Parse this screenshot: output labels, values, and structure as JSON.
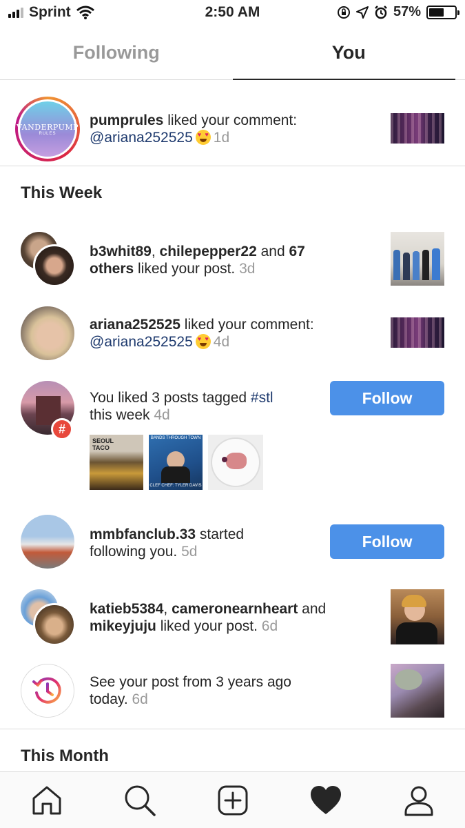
{
  "status_bar": {
    "carrier": "Sprint",
    "time": "2:50 AM",
    "battery": "57%",
    "battery_level": 0.57
  },
  "tabs": [
    {
      "label": "Following",
      "active": false
    },
    {
      "label": "You",
      "active": true
    }
  ],
  "top_notification": {
    "user": "pumprules",
    "action": " liked your comment:",
    "mention": "@ariana252525",
    "time": "1d",
    "avatar_text": "VANDERPUMP",
    "avatar_subtext": "RULES"
  },
  "sections": {
    "this_week": "This Week",
    "this_month": "This Month"
  },
  "notifications": [
    {
      "user1": "b3whit89",
      "sep": ", ",
      "user2": "chilepepper22",
      "mid": " and ",
      "user3": "67",
      "line2_bold": "others",
      "line2_rest": " liked your post. ",
      "time": "3d"
    },
    {
      "user": "ariana252525",
      "action": " liked your comment:",
      "mention": "@ariana252525",
      "time": "4d"
    },
    {
      "prefix": "You liked 3 posts tagged ",
      "tag": "#stl",
      "line2": "this week ",
      "time": "4d",
      "button": "Follow",
      "thumbs": [
        {
          "caption": "SEOUL TACO"
        },
        {
          "caption": "BANDS THROUGH TOWN",
          "caption2": "CLEF CHEF: TYLER DAVIS"
        },
        {
          "caption": ""
        }
      ]
    },
    {
      "user": "mmbfanclub.33",
      "action": " started",
      "line2": "following you. ",
      "time": "5d",
      "button": "Follow"
    },
    {
      "user1": "katieb5384",
      "sep": ", ",
      "user2": "cameronearnheart",
      "mid": " and",
      "user3": "mikeyjuju",
      "line2_rest": " liked your post. ",
      "time": "6d"
    },
    {
      "line1": "See your post from 3 years ago",
      "line2": "today. ",
      "time": "6d"
    }
  ],
  "bottom_nav": [
    "home-icon",
    "search-icon",
    "add-post-icon",
    "activity-heart-icon",
    "profile-icon"
  ],
  "colors": {
    "accent_blue": "#4c91e8",
    "mention": "#1e3a6e",
    "muted": "#999999"
  }
}
